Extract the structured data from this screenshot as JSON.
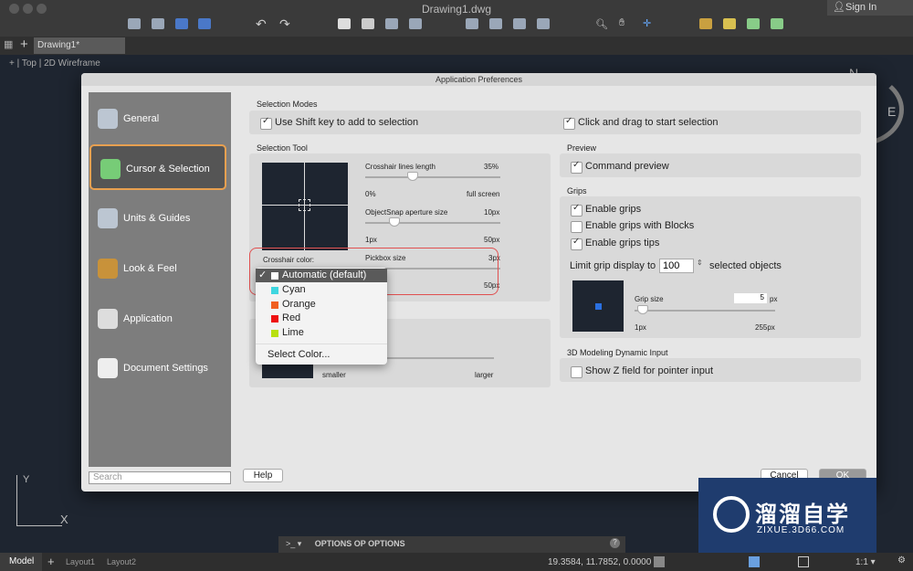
{
  "window": {
    "title": "Drawing1.dwg",
    "sign_in": "Sign In"
  },
  "tabs": {
    "doc_tab": "Drawing1*",
    "view_label": "+ | Top | 2D Wireframe"
  },
  "compass": {
    "north": "N",
    "east": "E"
  },
  "dialog": {
    "title": "Application Preferences",
    "sidebar": [
      {
        "label": "General",
        "icon": "gear-icon"
      },
      {
        "label": "Cursor & Selection",
        "icon": "cursor-icon",
        "active": true
      },
      {
        "label": "Units & Guides",
        "icon": "ruler-icon"
      },
      {
        "label": "Look & Feel",
        "icon": "brush-icon"
      },
      {
        "label": "Application",
        "icon": "window-icon"
      },
      {
        "label": "Document Settings",
        "icon": "document-icon"
      }
    ],
    "search_placeholder": "Search",
    "help": "Help",
    "cancel": "Cancel",
    "ok": "OK",
    "selection_modes": {
      "title": "Selection Modes",
      "shift_add": "Use Shift key to add to selection",
      "shift_add_checked": true,
      "click_drag": "Click and drag to start selection",
      "click_drag_checked": true
    },
    "selection_tool": {
      "title": "Selection Tool",
      "crosshair_length": {
        "label": "Crosshair lines length",
        "value": "35%",
        "min": "0%",
        "max": "full screen",
        "fraction": 0.35
      },
      "aperture": {
        "label": "ObjectSnap aperture size",
        "value": "10px",
        "min": "1px",
        "max": "50px"
      },
      "pickbox": {
        "label": "Pickbox size",
        "value": "3px",
        "max": "50px"
      },
      "crosshair_color_label": "Crosshair color:"
    },
    "color_menu": {
      "items": [
        {
          "label": "Automatic (default)",
          "color": "#ffffff",
          "selected": true
        },
        {
          "label": "Cyan",
          "color": "#3fd6e0"
        },
        {
          "label": "Orange",
          "color": "#f06020"
        },
        {
          "label": "Red",
          "color": "#ee1111"
        },
        {
          "label": "Lime",
          "color": "#b8e010"
        }
      ],
      "select_color": "Select Color..."
    },
    "size_slider": {
      "min": "smaller",
      "max": "larger"
    },
    "preview": {
      "title": "Preview",
      "command_preview": "Command preview",
      "checked": true
    },
    "grips": {
      "title": "Grips",
      "enable": "Enable grips",
      "enable_checked": true,
      "blocks": "Enable grips with Blocks",
      "blocks_checked": false,
      "tips": "Enable grips tips",
      "tips_checked": true,
      "limit_prefix": "Limit grip display to",
      "limit_value": "100",
      "limit_suffix": "selected objects",
      "grip_size_label": "Grip size",
      "grip_size_value": "5",
      "grip_size_unit": "px",
      "min": "1px",
      "max": "255px"
    },
    "modeling": {
      "title": "3D Modeling Dynamic Input",
      "show_z": "Show Z field for pointer input",
      "checked": false
    }
  },
  "command": {
    "prompt": ">_ ▾",
    "text": "OPTIONS OP OPTIONS"
  },
  "status": {
    "model": "Model",
    "layout1": "Layout1",
    "layout2": "Layout2",
    "coords": "19.3584, 11.7852, 0.0000",
    "scale": "1:1 ▾"
  },
  "watermark": {
    "brand": "溜溜自学",
    "url": "ZIXUE.3D66.COM"
  },
  "ucs": {
    "x": "X",
    "y": "Y"
  }
}
